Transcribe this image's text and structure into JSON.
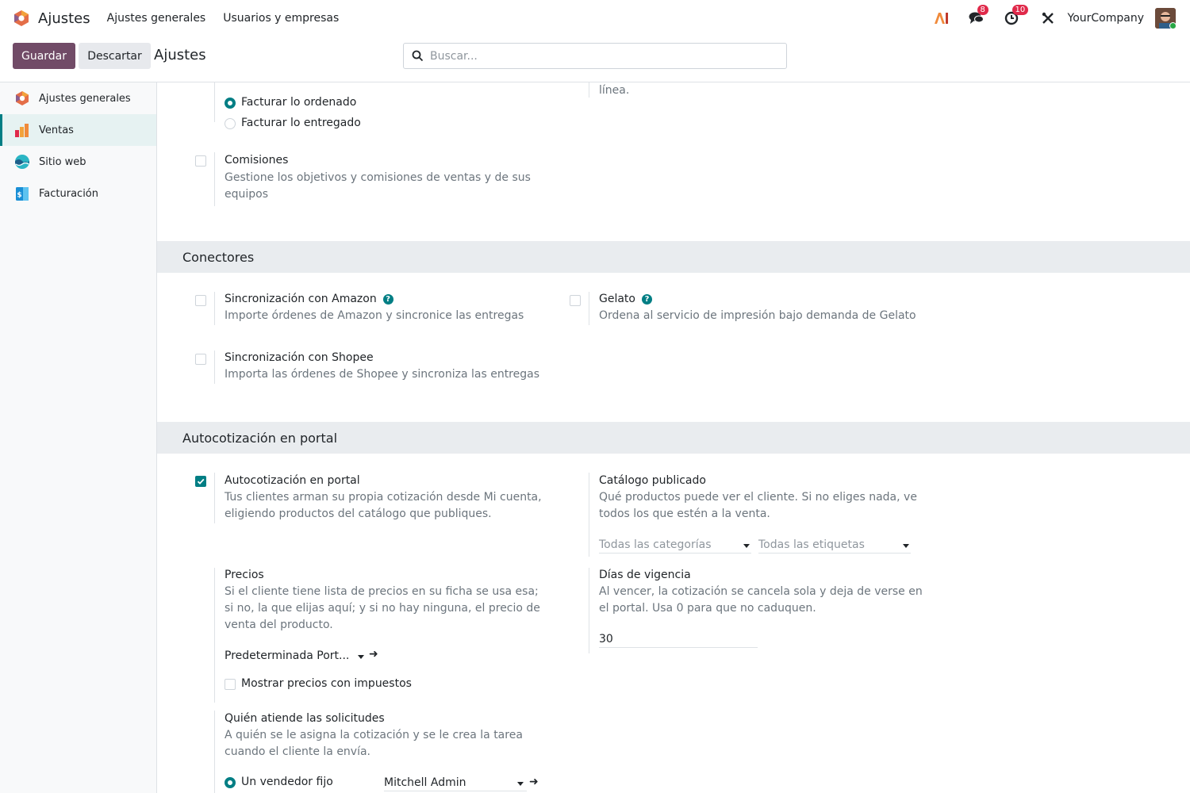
{
  "navbar": {
    "app_name": "Ajustes",
    "menu": [
      "Ajustes generales",
      "Usuarios y empresas"
    ],
    "messages_count": "8",
    "activities_count": "10",
    "company": "YourCompany"
  },
  "control": {
    "save_label": "Guardar",
    "discard_label": "Descartar",
    "title": "Ajustes",
    "search_placeholder": "Buscar..."
  },
  "sidebar": {
    "items": [
      {
        "label": "Ajustes generales",
        "icon": "settings-app-icon"
      },
      {
        "label": "Ventas",
        "icon": "sales-app-icon",
        "active": true
      },
      {
        "label": "Sitio web",
        "icon": "website-app-icon"
      },
      {
        "label": "Facturación",
        "icon": "invoicing-app-icon"
      }
    ]
  },
  "invoicing": {
    "right_desc_tail": "línea.",
    "policy_options": [
      "Facturar lo ordenado",
      "Facturar lo entregado"
    ],
    "selected_policy": "Facturar lo ordenado"
  },
  "commissions": {
    "title": "Comisiones",
    "desc": "Gestione los objetivos y comisiones de ventas y de sus equipos",
    "checked": false
  },
  "connectors": {
    "heading": "Conectores",
    "amazon": {
      "title": "Sincronización con Amazon",
      "desc": "Importe órdenes de Amazon y sincronice las entregas",
      "checked": false
    },
    "gelato": {
      "title": "Gelato",
      "desc": "Ordena al servicio de impresión bajo demanda de Gelato",
      "checked": false
    },
    "shopee": {
      "title": "Sincronización con Shopee",
      "desc": "Importa las órdenes de Shopee y sincroniza las entregas",
      "checked": false
    }
  },
  "portal": {
    "heading": "Autocotización en portal",
    "self_quote": {
      "title": "Autocotización en portal",
      "desc": "Tus clientes arman su propia cotización desde Mi cuenta, eligiendo productos del catálogo que publiques.",
      "checked": true
    },
    "catalog": {
      "title": "Catálogo publicado",
      "desc": "Qué productos puede ver el cliente. Si no eliges nada, ve todos los que estén a la venta.",
      "categories_placeholder": "Todas las categorías",
      "tags_placeholder": "Todas las etiquetas"
    },
    "prices": {
      "title": "Precios",
      "desc": "Si el cliente tiene lista de precios en su ficha se usa esa; si no, la que elijas aquí; y si no hay ninguna, el precio de venta del producto.",
      "pricelist_value": "Predeterminada Port...",
      "show_taxes_label": "Mostrar precios con impuestos",
      "show_taxes_checked": false
    },
    "validity": {
      "title": "Días de vigencia",
      "desc": "Al vencer, la cotización se cancela sola y deja de verse en el portal. Usa 0 para que no caduquen.",
      "value": "30"
    },
    "assignee": {
      "title": "Quién atiende las solicitudes",
      "desc": "A quién se le asigna la cotización y se le crea la tarea cuando el cliente la envía.",
      "option_label": "Un vendedor fijo",
      "option_selected": true,
      "user_value": "Mitchell Admin"
    }
  },
  "colors": {
    "primary": "#714b67",
    "accent": "#017e84",
    "badge": "#e0294a"
  }
}
